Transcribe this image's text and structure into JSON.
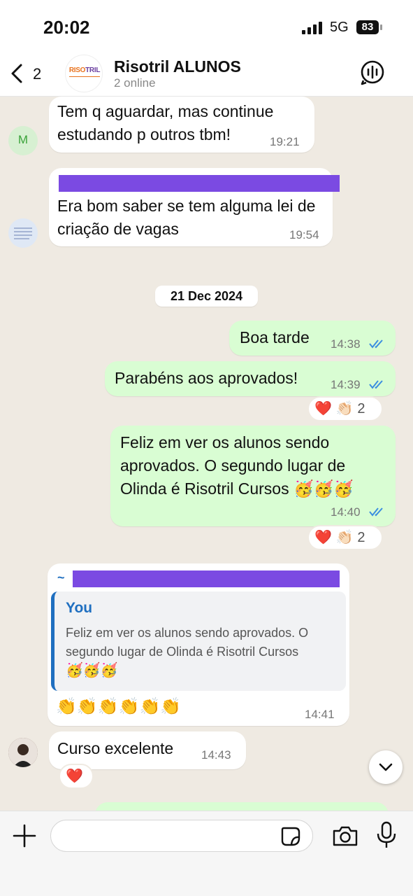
{
  "status_bar": {
    "time": "20:02",
    "network": "5G",
    "battery": "83"
  },
  "header": {
    "back_count": "2",
    "group_name": "Risotril ALUNOS",
    "group_status": "2 online",
    "logo_text_a": "RISO",
    "logo_text_b": "TRIL"
  },
  "messages": [
    {
      "direction": "incoming",
      "avatar_initial": "M",
      "text": "Tem q aguardar, mas continue estudando p outros tbm!",
      "time": "19:21"
    },
    {
      "direction": "incoming",
      "sender_redacted": true,
      "text": "Era bom saber se tem alguma lei de criação de vagas",
      "time": "19:54"
    },
    {
      "direction": "outgoing",
      "text": "Boa tarde",
      "time": "14:38"
    },
    {
      "direction": "outgoing",
      "text": "Parabéns aos aprovados!",
      "time": "14:39",
      "reactions": "❤️ 👏🏻",
      "reaction_count": "2"
    },
    {
      "direction": "outgoing",
      "text": "Feliz em ver os alunos sendo aprovados. O segundo lugar de Olinda é Risotril Cursos 🥳🥳🥳",
      "time": "14:40",
      "reactions": "❤️ 👏🏻",
      "reaction_count": "2"
    },
    {
      "direction": "incoming",
      "sender_prefix": "~",
      "sender_redacted": true,
      "quote": {
        "author": "You",
        "text": "Feliz em ver os alunos sendo aprovados. O segundo lugar de Olinda é Risotril Cursos",
        "emoji": "🥳🥳🥳"
      },
      "text": "👏👏👏👏👏👏",
      "time": "14:41"
    },
    {
      "direction": "incoming",
      "text": "Curso excelente",
      "time": "14:43",
      "reactions": "❤️"
    }
  ],
  "date_separator": "21 Dec 2024",
  "input": {
    "placeholder": ""
  },
  "colors": {
    "outgoing": "#d9fdd3",
    "incoming": "#ffffff",
    "background": "#efeae2",
    "accent": "#1f6fc0",
    "redaction": "#7b4ae2"
  }
}
